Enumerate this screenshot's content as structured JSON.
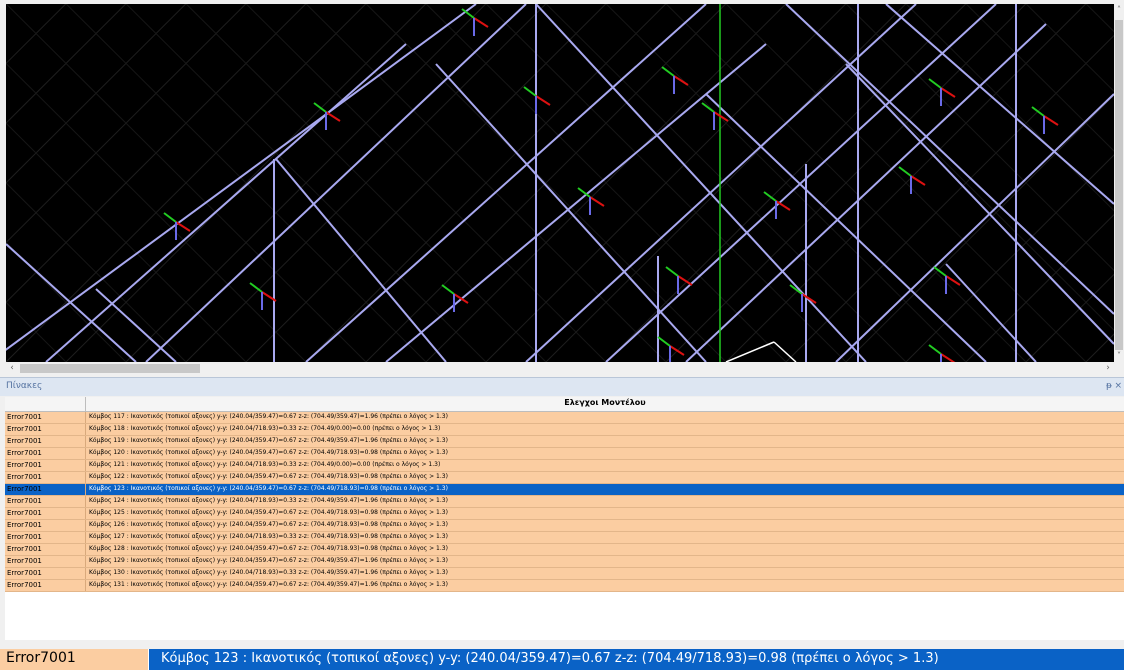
{
  "panel": {
    "title": "Πίνακες",
    "pin": "ᵽ",
    "close": "×"
  },
  "scroll": {
    "left": "‹",
    "right": "›",
    "up": "˄",
    "down": "˅"
  },
  "grid": {
    "header": "Ελεγχοι Μοντέλου",
    "rows": [
      {
        "code": "Error7001",
        "text": "Κόμβος 117 : Ικανοτικός (τοπικοί αξονες) y-y: (240.04/359.47)=0.67 z-z: (704.49/359.47)=1.96 (πρέπει ο λόγος > 1.3)",
        "selected": false
      },
      {
        "code": "Error7001",
        "text": "Κόμβος 118 : Ικανοτικός (τοπικοί αξονες) y-y: (240.04/718.93)=0.33 z-z: (704.49/0.00)=0.00 (πρέπει ο λόγος > 1.3)",
        "selected": false
      },
      {
        "code": "Error7001",
        "text": "Κόμβος 119 : Ικανοτικός (τοπικοί αξονες) y-y: (240.04/359.47)=0.67 z-z: (704.49/359.47)=1.96 (πρέπει ο λόγος > 1.3)",
        "selected": false
      },
      {
        "code": "Error7001",
        "text": "Κόμβος 120 : Ικανοτικός (τοπικοί αξονες) y-y: (240.04/359.47)=0.67 z-z: (704.49/718.93)=0.98 (πρέπει ο λόγος > 1.3)",
        "selected": false
      },
      {
        "code": "Error7001",
        "text": "Κόμβος 121 : Ικανοτικός (τοπικοί αξονες) y-y: (240.04/718.93)=0.33 z-z: (704.49/0.00)=0.00 (πρέπει ο λόγος > 1.3)",
        "selected": false
      },
      {
        "code": "Error7001",
        "text": "Κόμβος 122 : Ικανοτικός (τοπικοί αξονες) y-y: (240.04/359.47)=0.67 z-z: (704.49/718.93)=0.98 (πρέπει ο λόγος > 1.3)",
        "selected": false
      },
      {
        "code": "Error7001",
        "text": "Κόμβος 123 : Ικανοτικός (τοπικοί αξονες) y-y: (240.04/359.47)=0.67 z-z: (704.49/718.93)=0.98 (πρέπει ο λόγος > 1.3)",
        "selected": true
      },
      {
        "code": "Error7001",
        "text": "Κόμβος 124 : Ικανοτικός (τοπικοί αξονες) y-y: (240.04/718.93)=0.33 z-z: (704.49/359.47)=1.96 (πρέπει ο λόγος > 1.3)",
        "selected": false
      },
      {
        "code": "Error7001",
        "text": "Κόμβος 125 : Ικανοτικός (τοπικοί αξονες) y-y: (240.04/359.47)=0.67 z-z: (704.49/718.93)=0.98 (πρέπει ο λόγος > 1.3)",
        "selected": false
      },
      {
        "code": "Error7001",
        "text": "Κόμβος 126 : Ικανοτικός (τοπικοί αξονες) y-y: (240.04/359.47)=0.67 z-z: (704.49/718.93)=0.98 (πρέπει ο λόγος > 1.3)",
        "selected": false
      },
      {
        "code": "Error7001",
        "text": "Κόμβος 127 : Ικανοτικός (τοπικοί αξονες) y-y: (240.04/718.93)=0.33 z-z: (704.49/718.93)=0.98 (πρέπει ο λόγος > 1.3)",
        "selected": false
      },
      {
        "code": "Error7001",
        "text": "Κόμβος 128 : Ικανοτικός (τοπικοί αξονες) y-y: (240.04/359.47)=0.67 z-z: (704.49/718.93)=0.98 (πρέπει ο λόγος > 1.3)",
        "selected": false
      },
      {
        "code": "Error7001",
        "text": "Κόμβος 129 : Ικανοτικός (τοπικοί αξονες) y-y: (240.04/359.47)=0.67 z-z: (704.49/359.47)=1.96 (πρέπει ο λόγος > 1.3)",
        "selected": false
      },
      {
        "code": "Error7001",
        "text": "Κόμβος 130 : Ικανοτικός (τοπικοί αξονες) y-y: (240.04/718.93)=0.33 z-z: (704.49/359.47)=1.96 (πρέπει ο λόγος > 1.3)",
        "selected": false
      },
      {
        "code": "Error7001",
        "text": "Κόμβος 131 : Ικανοτικός (τοπικοί αξονες) y-y: (240.04/359.47)=0.67 z-z: (704.49/359.47)=1.96 (πρέπει ο λόγος > 1.3)",
        "selected": false
      }
    ]
  },
  "status": {
    "code": "Error7001",
    "message": "Κόμβος 123 : Ικανοτικός (τοπικοί αξονες) y-y: (240.04/359.47)=0.67 z-z: (704.49/718.93)=0.98 (πρέπει ο λόγος > 1.3)"
  },
  "colors": {
    "viewport_bg": "#000000",
    "member": "#a9a9f0",
    "axis_y": "#22cc22",
    "axis_red": "#dd1111",
    "axis_z": "#6a6ae8",
    "row_bg": "#fbcda1",
    "selected": "#0a62c6"
  }
}
